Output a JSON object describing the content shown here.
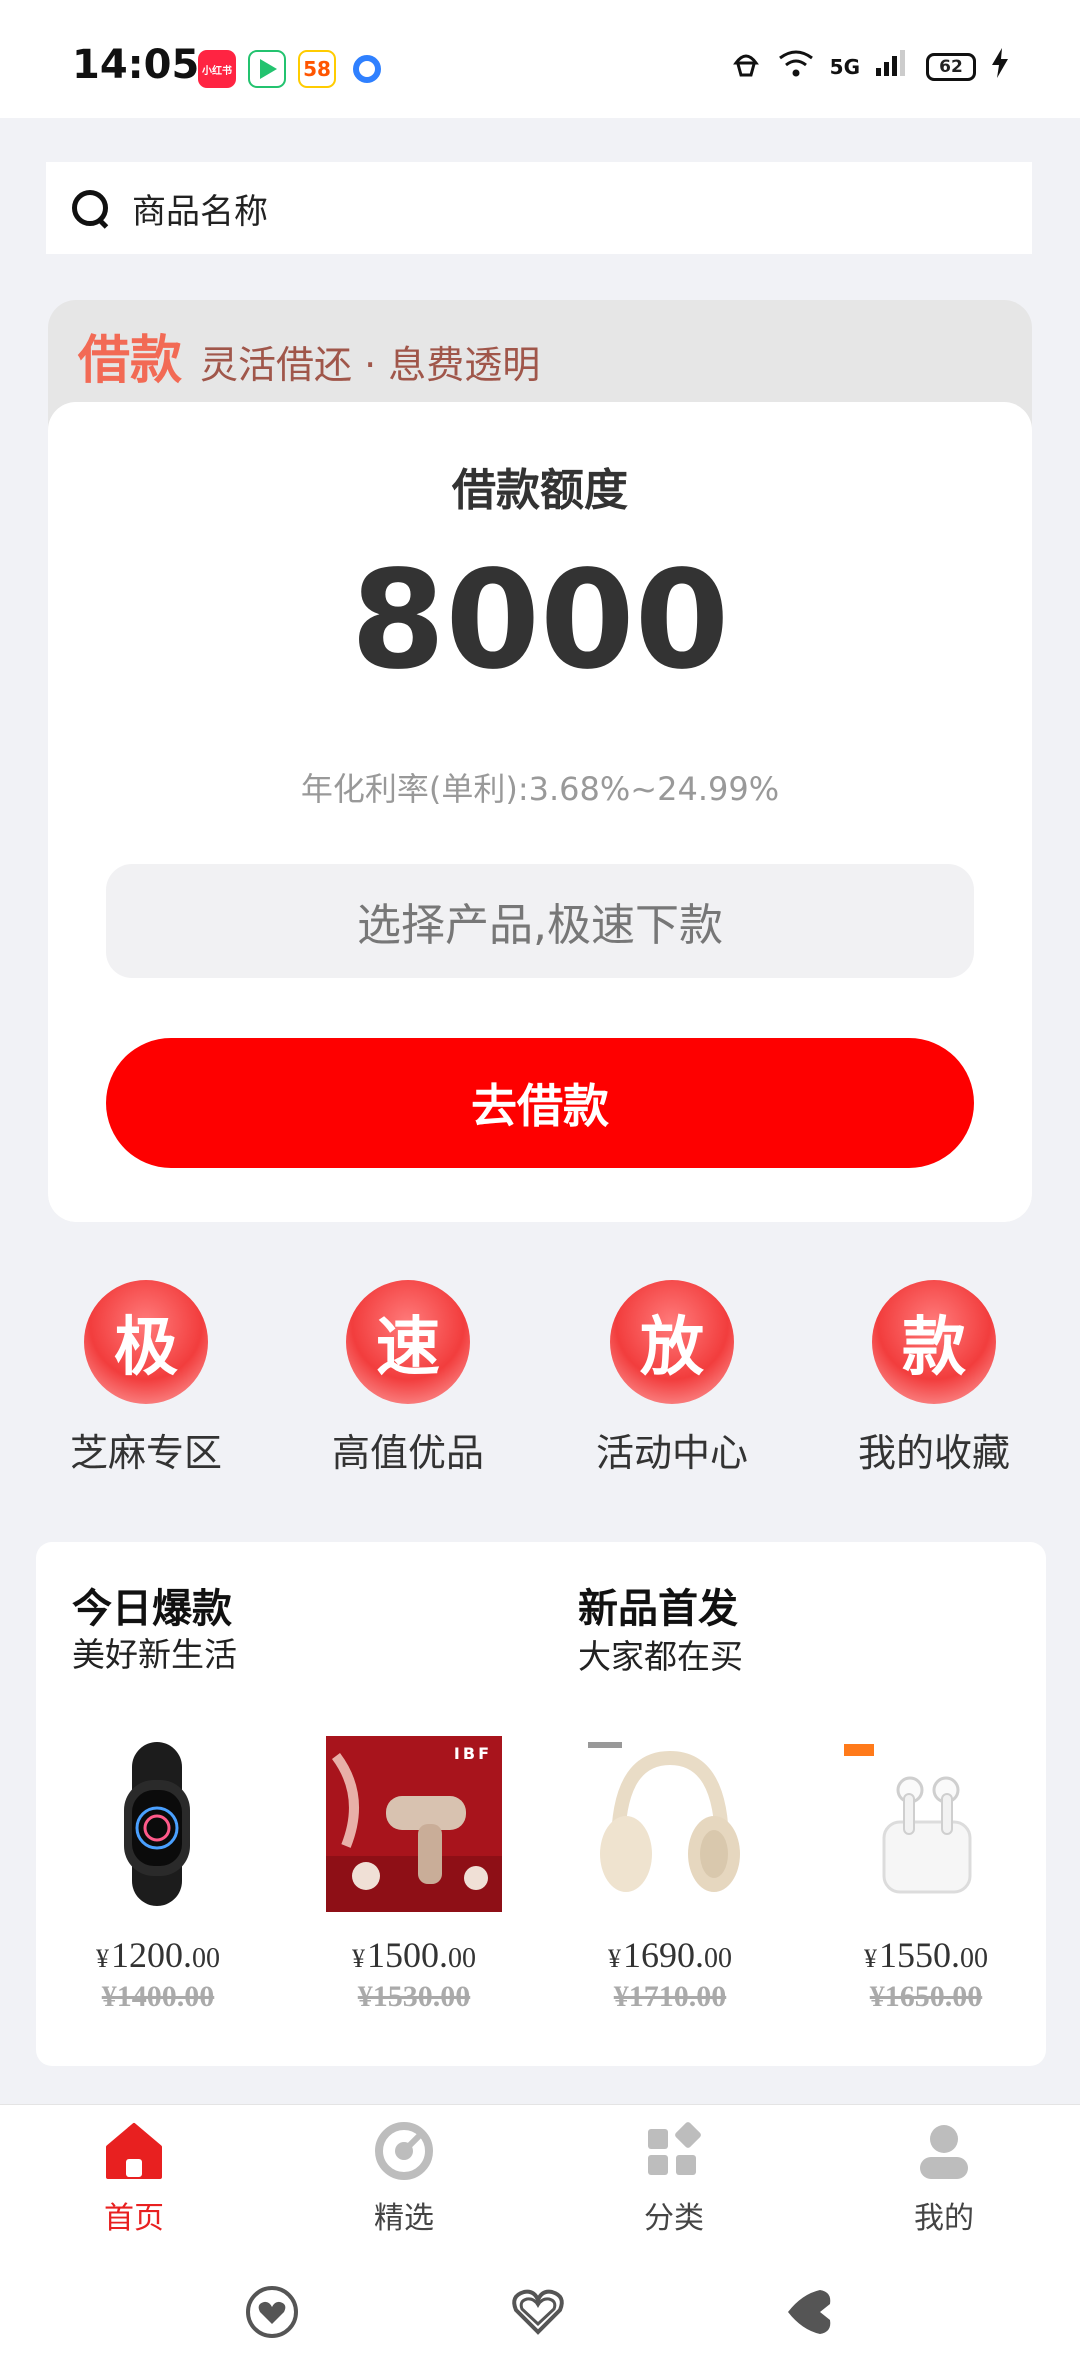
{
  "status_bar": {
    "time": "14:05",
    "apps": [
      {
        "name": "xiaohongshu-icon",
        "label": "小红书",
        "color": "#ff2442"
      },
      {
        "name": "video-app-icon",
        "label": "",
        "color": "#23c36f"
      },
      {
        "name": "58-icon",
        "label": "58",
        "color": "#ff8a00"
      },
      {
        "name": "browser-icon",
        "label": "",
        "color": "#2f80ff"
      }
    ],
    "network": "5G",
    "battery": "62"
  },
  "search": {
    "placeholder": "商品名称"
  },
  "loan": {
    "tag": "借款",
    "slogan": "灵活借还 · 息费透明",
    "title": "借款额度",
    "amount": "8000",
    "rate": "年化利率(单利):3.68%~24.99%",
    "select_label": "选择产品,极速下款",
    "button_label": "去借款"
  },
  "quick_links": [
    {
      "char": "极",
      "label": "芝麻专区"
    },
    {
      "char": "速",
      "label": "高值优品"
    },
    {
      "char": "放",
      "label": "活动中心"
    },
    {
      "char": "款",
      "label": "我的收藏"
    }
  ],
  "sections": {
    "hot": {
      "title": "今日爆款",
      "subtitle": "美好新生活"
    },
    "new": {
      "title": "新品首发",
      "subtitle": "大家都在买"
    }
  },
  "products": [
    {
      "image": "fitness-band",
      "yen": "¥",
      "price_int": "1200.",
      "price_dec": "00",
      "old_price": "¥1400.00"
    },
    {
      "image": "massage-gun",
      "yen": "¥",
      "price_int": "1500.",
      "price_dec": "00",
      "old_price": "¥1530.00",
      "brand_text": "IBF"
    },
    {
      "image": "headphones",
      "yen": "¥",
      "price_int": "1690.",
      "price_dec": "00",
      "old_price": "¥1710.00"
    },
    {
      "image": "earbuds",
      "yen": "¥",
      "price_int": "1550.",
      "price_dec": "00",
      "old_price": "¥1650.00"
    }
  ],
  "tabs": [
    {
      "label": "首页",
      "icon": "home-icon",
      "active": true
    },
    {
      "label": "精选",
      "icon": "featured-icon",
      "active": false
    },
    {
      "label": "分类",
      "icon": "category-icon",
      "active": false
    },
    {
      "label": "我的",
      "icon": "profile-icon",
      "active": false
    }
  ],
  "colors": {
    "accent": "#fe0000",
    "tag": "#f26a55",
    "background": "#f1f2f6"
  }
}
